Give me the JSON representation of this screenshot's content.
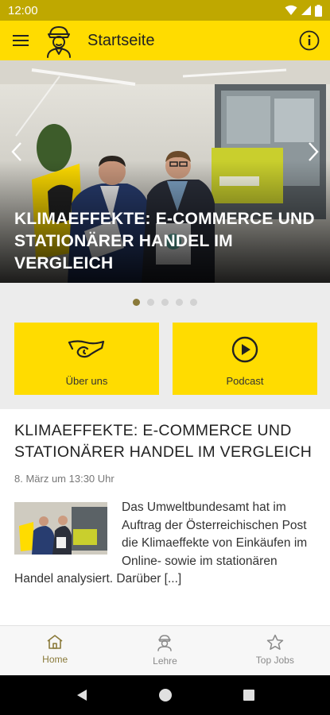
{
  "status_bar": {
    "time": "12:00"
  },
  "app_bar": {
    "title": "Startseite",
    "menu_icon": "hamburger-menu-icon",
    "mascot_icon": "mascot-avatar-icon",
    "info_icon": "info-icon"
  },
  "hero": {
    "headline": "KLIMAEFFEKTE: E-COMMERCE UND STATIONÄRER HANDEL IM VERGLEICH",
    "slide_count": 5,
    "active_slide": 1
  },
  "tiles": [
    {
      "label": "Über uns",
      "icon": "post-horn-icon"
    },
    {
      "label": "Podcast",
      "icon": "play-circle-icon"
    }
  ],
  "article": {
    "title": "KLIMAEFFEKTE: E-COMMERCE UND STATIONÄRER HANDEL IM VERGLEICH",
    "date": "8. März um 13:30 Uhr",
    "teaser": "Das Umweltbundesamt hat im Auftrag der Österreichischen Post die Klimaeffekte von Einkäufen im Online- sowie im stationären Handel analysiert. Darüber [...]"
  },
  "bottom_nav": {
    "items": [
      {
        "label": "Home",
        "icon": "home-icon",
        "active": true
      },
      {
        "label": "Lehre",
        "icon": "apprentice-icon",
        "active": false
      },
      {
        "label": "Top Jobs",
        "icon": "star-icon",
        "active": false
      }
    ]
  },
  "colors": {
    "brand_yellow": "#ffdc00",
    "status_bar": "#bfa800",
    "active_accent": "#8a7a3a"
  }
}
